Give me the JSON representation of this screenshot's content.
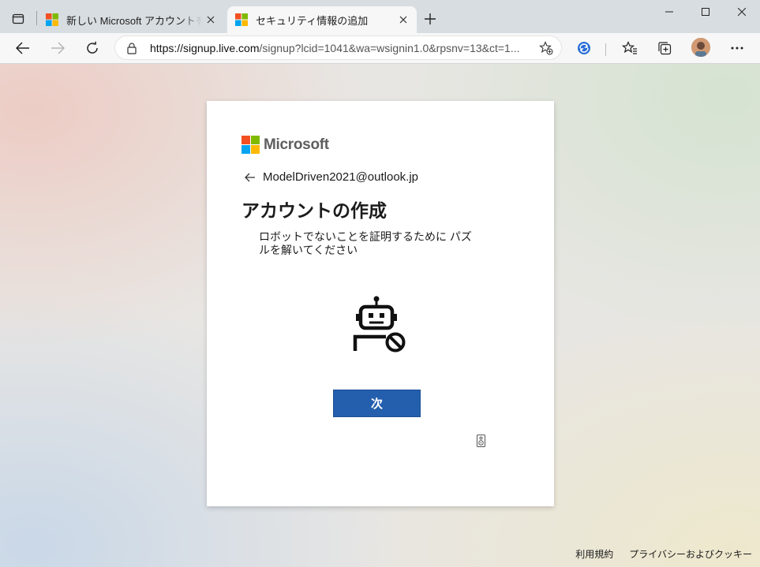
{
  "browser": {
    "tabs": [
      {
        "title": "新しい Microsoft アカウントを作成する",
        "active": false
      },
      {
        "title": "セキュリティ情報の追加",
        "active": true
      }
    ],
    "address": {
      "host": "https://signup.live.com",
      "path": "/signup?lcid=1041&wa=wsignin1.0&rpsnv=13&ct=1..."
    },
    "window_buttons": [
      "minimize",
      "maximize",
      "close"
    ],
    "toolbar_icons": [
      "back-icon",
      "forward-icon",
      "refresh-icon",
      "favorite-add-icon",
      "extension-icon",
      "favorites-icon",
      "collections-icon",
      "profile-avatar",
      "more-icon"
    ]
  },
  "card": {
    "brand": "Microsoft",
    "identity": "ModelDriven2021@outlook.jp",
    "heading": "アカウントの作成",
    "description": "ロボットでないことを証明するために パズルを解いてください",
    "next_label": "次"
  },
  "footer": {
    "terms": "利用規約",
    "privacy": "プライバシーおよびクッキー"
  },
  "colors": {
    "ms_red": "#f25022",
    "ms_green": "#7fba00",
    "ms_blue": "#00a4ef",
    "ms_yellow": "#ffb900",
    "button_blue": "#245fae"
  }
}
